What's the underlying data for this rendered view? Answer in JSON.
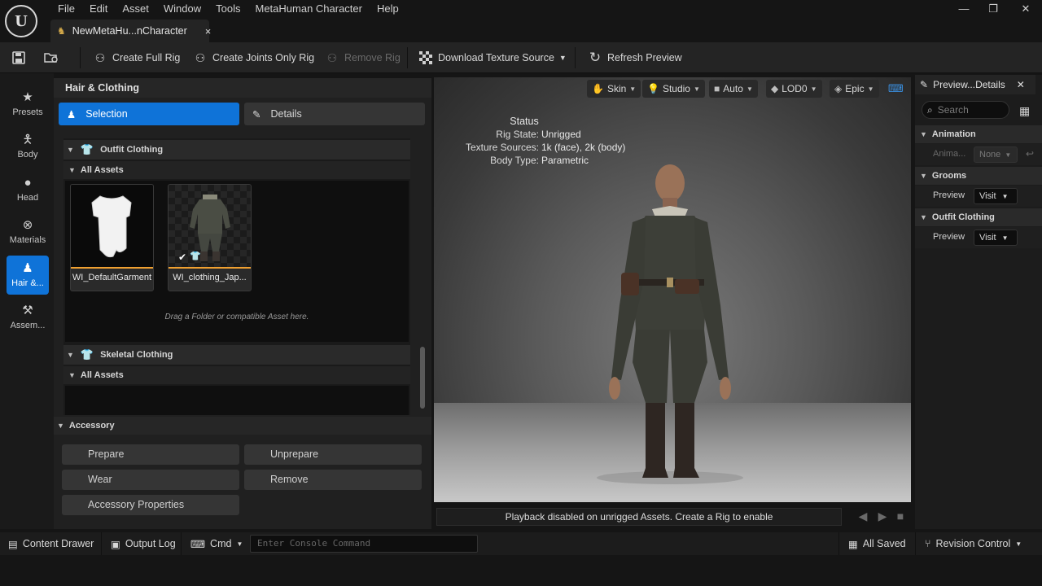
{
  "menu": [
    "File",
    "Edit",
    "Asset",
    "Window",
    "Tools",
    "MetaHuman Character",
    "Help"
  ],
  "window_controls": {
    "minimize": "—",
    "restore": "❐",
    "close": "✕"
  },
  "doc_tab": {
    "title": "NewMetaHu...nCharacter",
    "close": "×"
  },
  "toolbar": {
    "create_full_rig": "Create Full Rig",
    "create_joints_only_rig": "Create Joints Only Rig",
    "remove_rig": "Remove Rig",
    "download_texture_source": "Download Texture Source",
    "refresh_preview": "Refresh Preview"
  },
  "categories": [
    {
      "label": "Presets",
      "icon": "star-icon"
    },
    {
      "label": "Body",
      "icon": "body-icon"
    },
    {
      "label": "Head",
      "icon": "head-icon"
    },
    {
      "label": "Materials",
      "icon": "materials-icon"
    },
    {
      "label": "Hair &...",
      "icon": "hair-clothing-icon",
      "active": true
    },
    {
      "label": "Assem...",
      "icon": "assembly-icon"
    }
  ],
  "panel": {
    "title": "Hair & Clothing",
    "selection_tab": "Selection",
    "details_tab": "Details",
    "outfit_group": "Outfit Clothing",
    "all_assets": "All Assets",
    "assets": [
      {
        "label": "WI_DefaultGarment"
      },
      {
        "label": "WI_clothing_Jap..."
      }
    ],
    "drop_hint": "Drag a Folder or compatible Asset here.",
    "skeletal_group": "Skeletal Clothing",
    "skeletal_all_assets": "All Assets",
    "accessory": {
      "title": "Accessory",
      "prepare": "Prepare",
      "unprepare": "Unprepare",
      "wear": "Wear",
      "remove": "Remove",
      "properties": "Accessory Properties"
    }
  },
  "viewport": {
    "buttons": {
      "skin": "Skin",
      "studio": "Studio",
      "auto": "Auto",
      "lod": "LOD0",
      "epic": "Epic"
    },
    "status": {
      "title": "Status",
      "rig_state_label": "Rig State:",
      "rig_state_value": "Unrigged",
      "texture_label": "Texture Sources:",
      "texture_value": "1k (face), 2k (body)",
      "body_type_label": "Body Type:",
      "body_type_value": "Parametric"
    },
    "playback": "Playback disabled on unrigged Assets. Create a Rig to enable"
  },
  "details_panel": {
    "tab_title": "Preview...Details",
    "search_placeholder": "Search",
    "animation": {
      "title": "Animation",
      "label": "Anima...",
      "value": "None"
    },
    "grooms": {
      "title": "Grooms",
      "label": "Preview",
      "value": "Visit"
    },
    "outfit": {
      "title": "Outfit Clothing",
      "label": "Preview",
      "value": "Visit"
    }
  },
  "statusbar": {
    "content_drawer": "Content Drawer",
    "output_log": "Output Log",
    "cmd": "Cmd",
    "console_placeholder": "Enter Console Command",
    "all_saved": "All Saved",
    "revision_control": "Revision Control"
  },
  "colors": {
    "accent": "#0f73d8",
    "thumb_underline": "#f0a030"
  }
}
